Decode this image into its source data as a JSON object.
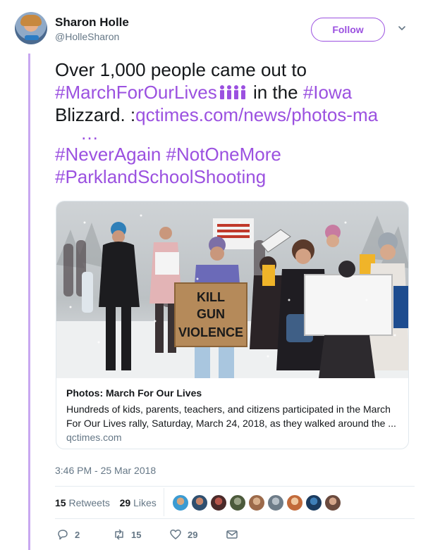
{
  "author": {
    "name": "Sharon Holle",
    "handle": "@HolleSharon"
  },
  "follow_label": "Follow",
  "tweet": {
    "text_part1": "Over 1,000 people came out to",
    "hashtag_march": "#MarchForOurLives",
    "text_in_the": "in the",
    "hashtag_iowa": "#Iowa",
    "text_blizzard": "Blizzard. :",
    "url_text": "qctimes.com/news/photos-ma",
    "url_ellipsis": "…",
    "hashtag_neveragain": "#NeverAgain",
    "hashtag_notonemore": "#NotOneMore",
    "hashtag_parkland": "#ParklandSchoolShooting"
  },
  "card": {
    "title": "Photos: March For Our Lives",
    "description": "Hundreds of kids, parents, teachers, and citizens participated in the March For Our Lives rally, Saturday, March 24, 2018, as they walked around the ...",
    "domain": "qctimes.com",
    "sign_text": [
      "KILL",
      "GUN",
      "VIOLENCE"
    ],
    "small_sign_text": [
      "STUDENTS",
      "DEMAND",
      "ACTION"
    ]
  },
  "timestamp": "3:46 PM - 25 Mar 2018",
  "stats": {
    "retweets_count": "15",
    "retweets_label": "Retweets",
    "likes_count": "29",
    "likes_label": "Likes"
  },
  "actions": {
    "reply_count": "2",
    "retweet_count": "15",
    "like_count": "29"
  },
  "colors": {
    "accent": "#9b51e0",
    "thread_line": "#c8a8f0",
    "secondary_text": "#657786"
  }
}
